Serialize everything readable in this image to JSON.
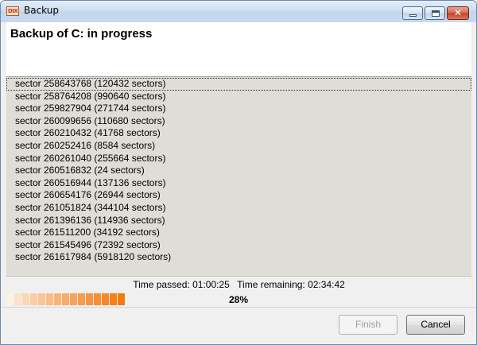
{
  "window": {
    "title": "Backup",
    "icon_label": "DIX"
  },
  "header": {
    "title": "Backup of C: in progress"
  },
  "sectors": [
    "sector 258643768 (120432 sectors)",
    "sector 258764208 (990640 sectors)",
    "sector 259827904 (271744 sectors)",
    "sector 260099656 (110680 sectors)",
    "sector 260210432 (41768 sectors)",
    "sector 260252416 (8584 sectors)",
    "sector 260261040 (255664 sectors)",
    "sector 260516832 (24 sectors)",
    "sector 260516944 (137136 sectors)",
    "sector 260654176 (26944 sectors)",
    "sector 261051824 (344104 sectors)",
    "sector 261396136 (114936 sectors)",
    "sector 261511200 (34192 sectors)",
    "sector 261545496 (72392 sectors)",
    "sector 261617984 (5918120 sectors)"
  ],
  "status": {
    "time_passed": "Time passed: 01:00:25",
    "time_remaining": "Time remaining: 02:34:42",
    "progress_percent_label": "28%",
    "progress_fraction": 0.28
  },
  "buttons": {
    "finish": "Finish",
    "cancel": "Cancel"
  },
  "colors": {
    "progress_start": "#fdf0e4",
    "progress_end": "#f47a10",
    "list_background": "#e0ddd7"
  }
}
